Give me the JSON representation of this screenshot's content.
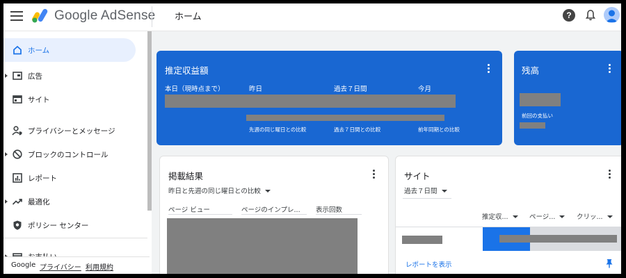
{
  "app": {
    "product": "Google AdSense",
    "page_title": "ホーム"
  },
  "sidebar": {
    "items": [
      {
        "label": "ホーム",
        "icon": "home-icon",
        "active": true
      },
      {
        "label": "広告",
        "icon": "ads-icon",
        "expandable": true
      },
      {
        "label": "サイト",
        "icon": "sites-icon"
      },
      {
        "label": "プライバシーとメッセージ",
        "icon": "privacy-messaging-icon"
      },
      {
        "label": "ブロックのコントロール",
        "icon": "block-icon",
        "expandable": true
      },
      {
        "label": "レポート",
        "icon": "reports-icon"
      },
      {
        "label": "最適化",
        "icon": "optimization-icon",
        "expandable": true
      },
      {
        "label": "ポリシー センター",
        "icon": "policy-center-icon"
      },
      {
        "label": "お支払い",
        "icon": "payments-icon",
        "expandable": true
      }
    ],
    "footer": {
      "brand": "Google",
      "privacy": "プライバシー",
      "terms": "利用規約"
    }
  },
  "earnings_card": {
    "title": "推定収益額",
    "columns": [
      "本日（現時点まで）",
      "昨日",
      "過去７日間",
      "今月"
    ],
    "comparisons": [
      "先週の同じ曜日との比較",
      "過去７日間との比較",
      "前年同期との比較"
    ]
  },
  "balance_card": {
    "title": "残高",
    "last_payment_label": "前回の支払い"
  },
  "performance_card": {
    "title": "掲載結果",
    "dropdown": "昨日と先週の同じ曜日との比較",
    "headers": [
      "ページ ビュー",
      "ページのインプレ...",
      "表示回数"
    ]
  },
  "sites_card": {
    "title": "サイト",
    "dropdown": "過去７日間",
    "headers": [
      "推定収...",
      "ページ...",
      "クリッ..."
    ],
    "link": "レポートを表示"
  },
  "colors": {
    "accent_blue": "#1967d2",
    "link_blue": "#1a73e8",
    "redaction_gray": "#808080"
  }
}
